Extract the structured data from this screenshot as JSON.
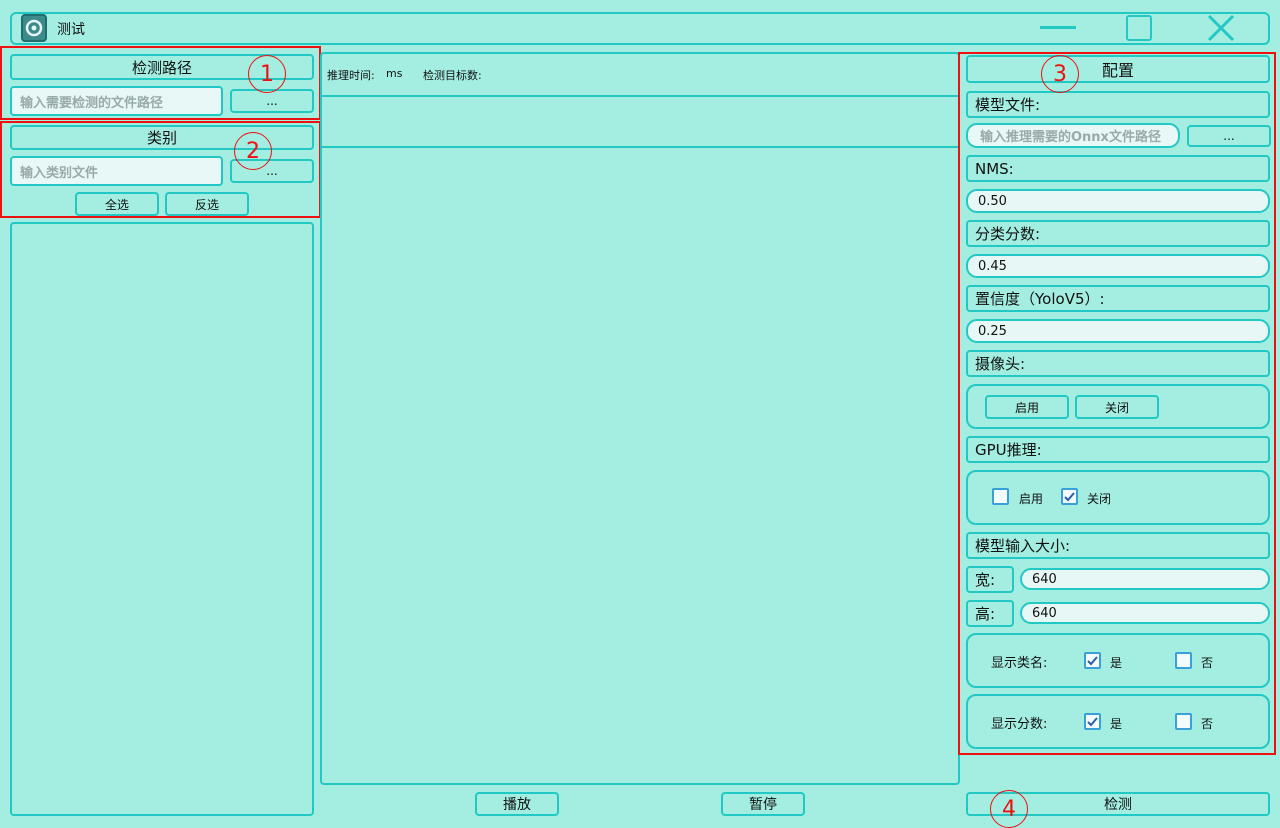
{
  "window": {
    "title": "测试"
  },
  "left": {
    "path_header": "检测路径",
    "path_placeholder": "输入需要检测的文件路径",
    "browse_label": "...",
    "class_header": "类别",
    "class_placeholder": "输入类别文件",
    "class_browse_label": "...",
    "select_all": "全选",
    "invert_select": "反选"
  },
  "center": {
    "infer_time_label": "推理时间:",
    "infer_time_unit": "ms",
    "target_count_label": "检测目标数:",
    "play_button": "播放",
    "pause_button": "暂停"
  },
  "config": {
    "header": "配置",
    "model_file_label": "模型文件:",
    "model_placeholder": "输入推理需要的Onnx文件路径",
    "model_browse": "...",
    "nms_label": "NMS:",
    "nms_value": "0.50",
    "cls_score_label": "分类分数:",
    "cls_score_value": "0.45",
    "conf_label": "置信度（YoloV5）:",
    "conf_value": "0.25",
    "camera_label": "摄像头:",
    "camera_on": "启用",
    "camera_off": "关闭",
    "gpu_label": "GPU推理:",
    "gpu_on": "启用",
    "gpu_off": "关闭",
    "gpu_on_checked": false,
    "gpu_off_checked": true,
    "input_size_label": "模型输入大小:",
    "width_label": "宽:",
    "width_value": "640",
    "height_label": "高:",
    "height_value": "640",
    "show_class_label": "显示类名:",
    "show_score_label": "显示分数:",
    "yes": "是",
    "no": "否",
    "detect_button": "检测"
  },
  "annotations": [
    "1",
    "2",
    "3",
    "4"
  ],
  "colors": {
    "background": "#a3eee1",
    "border": "#22c8c4",
    "annotation": "#ee1111"
  },
  "icons": [
    "app-logo-icon",
    "minimize-icon",
    "maximize-icon",
    "close-icon",
    "checkmark-icon"
  ]
}
